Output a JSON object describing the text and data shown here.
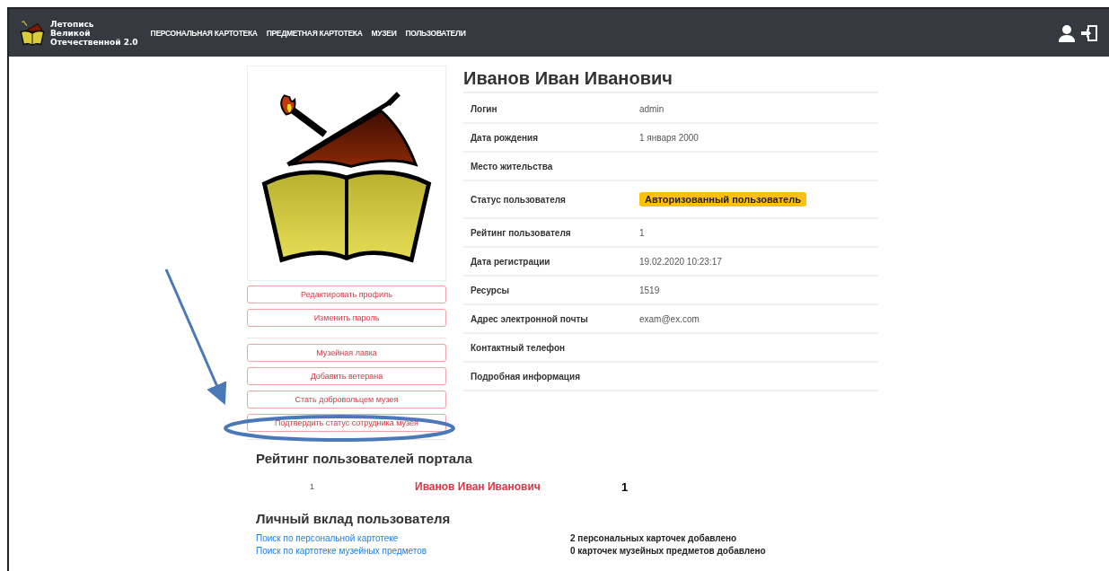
{
  "navbar": {
    "brand": [
      "Летопись",
      "Великой",
      "Отечественной 2.0"
    ],
    "items": [
      {
        "label": "ПЕРСОНАЛЬНАЯ КАРТОТЕКА"
      },
      {
        "label": "ПРЕДМЕТНАЯ КАРТОТЕКА"
      },
      {
        "label": "МУЗЕИ"
      },
      {
        "label": "ПОЛЬЗОВАТЕЛИ"
      }
    ]
  },
  "profile_buttons": [
    "Редактировать профиль",
    "Изменить пароль"
  ],
  "action_buttons": [
    "Музейная лавка",
    "Добавить ветерана",
    "Стать добровольцем музея",
    "Подтвердить статус сотрудника музея"
  ],
  "user": {
    "name": "Иванов Иван Иванович",
    "fields": [
      {
        "label": "Логин",
        "kind": "text",
        "value": "admin"
      },
      {
        "label": "Дата рождения",
        "kind": "text",
        "value": "1 января 2000"
      },
      {
        "label": "Место жительства",
        "kind": "text"
      },
      {
        "label": "Статус пользователя",
        "kind": "badge",
        "value": "Авторизованный пользователь"
      },
      {
        "label": "Рейтинг пользователя",
        "kind": "text",
        "value": "1"
      },
      {
        "label": "Дата регистрации",
        "kind": "text",
        "value": "19.02.2020 10:23:17"
      },
      {
        "label": "Ресурсы",
        "kind": "text",
        "value": "1519"
      },
      {
        "label": "Адрес электронной почты",
        "kind": "text",
        "value": "exam@ex.com"
      },
      {
        "label": "Контактный телефон",
        "kind": "text"
      },
      {
        "label": "Подробная информация",
        "kind": "text"
      }
    ]
  },
  "rating": {
    "title": "Рейтинг пользователей портала",
    "rows": [
      {
        "rank": "1",
        "name": "Иванов Иван Иванович",
        "score": "1"
      }
    ]
  },
  "contribution": {
    "title": "Личный вклад пользователя",
    "rows": [
      {
        "link": "Поиск по персональной картотеке",
        "text": "2 персональных карточек добавлено"
      },
      {
        "link": "Поиск по картотеке музейных предметов",
        "text": "0 карточек музейных предметов добавлено"
      }
    ]
  }
}
